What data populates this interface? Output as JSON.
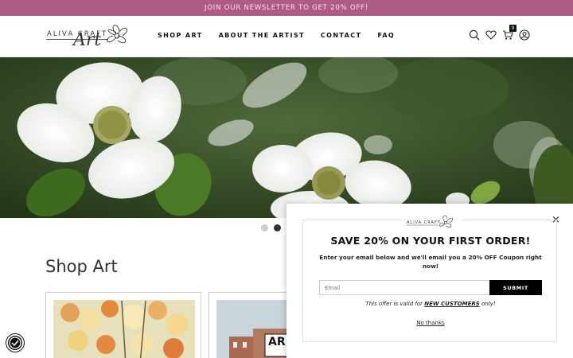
{
  "announcement": {
    "text": "JOIN OUR NEWSLETTER TO GET 20% OFF!"
  },
  "header": {
    "logo_text": "ALIVA CRAFT",
    "logo_script": "Art",
    "nav": [
      "SHOP ART",
      "ABOUT THE ARTIST",
      "CONTACT",
      "FAQ"
    ],
    "icons": [
      "search-icon",
      "heart-icon",
      "cart-icon",
      "account-icon"
    ],
    "cart_count": "0"
  },
  "hero": {
    "slides": 2,
    "active_slide": 2
  },
  "shop": {
    "title": "Shop Art",
    "card2_badge": "AR"
  },
  "popup": {
    "heading": "SAVE 20% ON YOUR FIRST ORDER!",
    "subtitle": "Enter your email below and we'll email you a 20% OFF Coupon right now!",
    "email_placeholder": "Email",
    "submit_label": "SUBMIT",
    "offer_prefix": "This offer is valid for",
    "offer_highlight": "NEW CUSTOMERS",
    "offer_suffix": "only!",
    "no_thanks": "No thanks",
    "close_label": "×"
  },
  "colors": {
    "announcement_bg": "#b05a86",
    "button_bg": "#000000"
  }
}
